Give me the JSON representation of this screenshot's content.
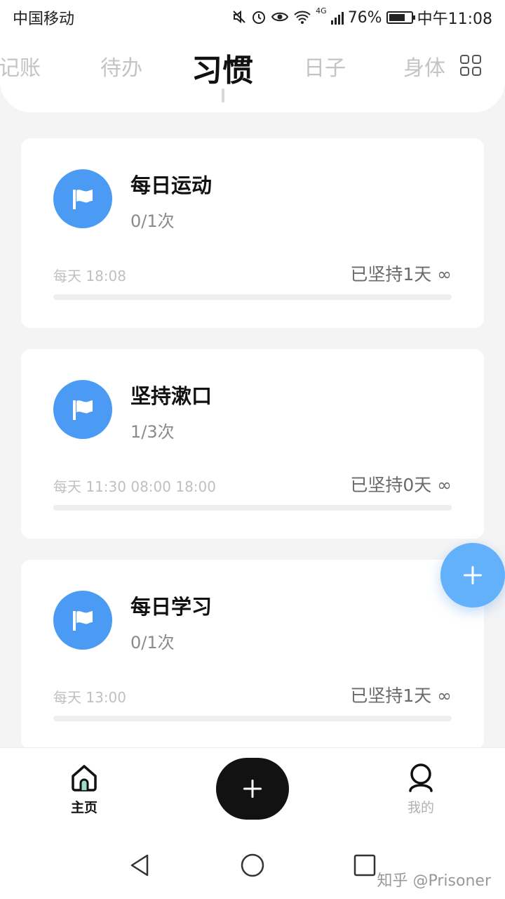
{
  "status_bar": {
    "carrier": "中国移动",
    "network_label": "4G",
    "battery_percent": "76%",
    "battery_level": 0.76,
    "time": "中午11:08",
    "icons": [
      "mute-icon",
      "alarm-icon",
      "eye-comfort-icon",
      "wifi-icon",
      "signal-icon",
      "battery-icon"
    ]
  },
  "tabs": [
    {
      "label": "记账",
      "active": false
    },
    {
      "label": "待办",
      "active": false
    },
    {
      "label": "习惯",
      "active": true
    },
    {
      "label": "日子",
      "active": false
    },
    {
      "label": "身体",
      "active": false
    }
  ],
  "habits": [
    {
      "title": "每日运动",
      "count": "0/1次",
      "schedule": "每天 18:08",
      "streak": "已坚持1天 ∞",
      "progress": 0,
      "icon": "flag-icon"
    },
    {
      "title": "坚持漱口",
      "count": "1/3次",
      "schedule": "每天 11:30 08:00 18:00",
      "streak": "已坚持0天 ∞",
      "progress": 0,
      "icon": "flag-icon"
    },
    {
      "title": "每日学习",
      "count": "0/1次",
      "schedule": "每天 13:00",
      "streak": "已坚持1天 ∞",
      "progress": 0,
      "icon": "flag-icon"
    }
  ],
  "bottom_nav": {
    "home_label": "主页",
    "me_label": "我的"
  },
  "watermark": "知乎 @Prisoner",
  "colors": {
    "accent_blue": "#4b9bf5",
    "fab_blue": "#63b1fb",
    "primary_text": "#111111",
    "muted_text": "#8a8a8a",
    "background": "#f4f4f4"
  }
}
